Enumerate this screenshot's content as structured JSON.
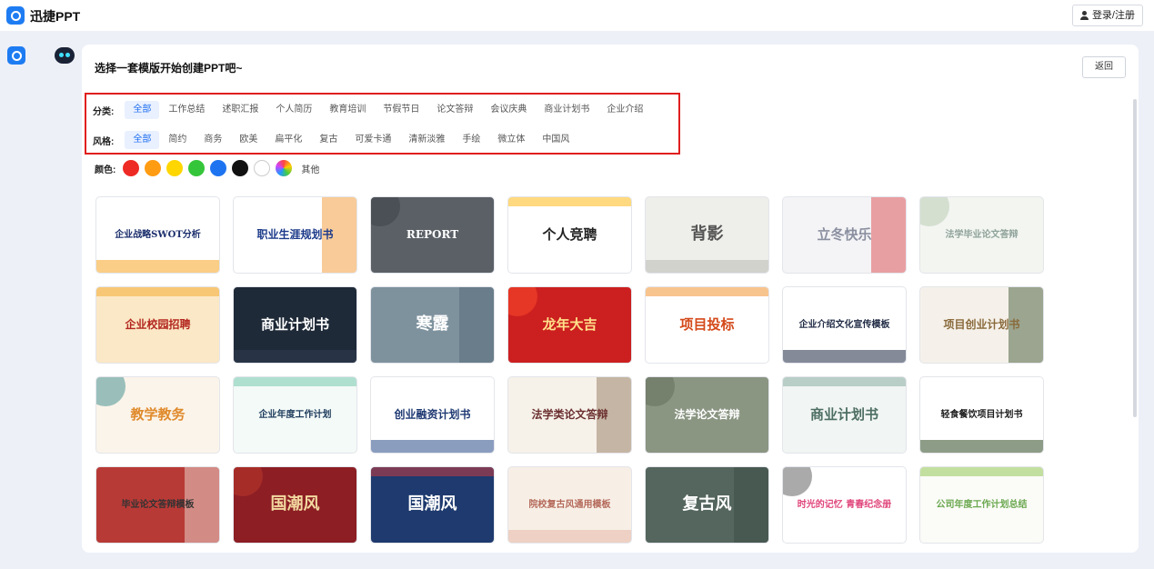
{
  "header": {
    "brand": "迅捷PPT",
    "login_label": "登录/注册"
  },
  "card": {
    "title": "选择一套模版开始创建PPT吧~",
    "back_label": "返回"
  },
  "filters": {
    "category_label": "分类:",
    "categories": [
      "全部",
      "工作总结",
      "述职汇报",
      "个人简历",
      "教育培训",
      "节假节日",
      "论文答辩",
      "会议庆典",
      "商业计划书",
      "企业介绍"
    ],
    "style_label": "风格:",
    "styles": [
      "全部",
      "简约",
      "商务",
      "欧美",
      "扁平化",
      "复古",
      "可爱卡通",
      "清新淡雅",
      "手绘",
      "微立体",
      "中国风"
    ],
    "color_label": "颜色:",
    "colors": [
      "#ee2a24",
      "#ff9c12",
      "#ffd600",
      "#35c53a",
      "#1e74f0",
      "#111111",
      "#ffffff",
      "rainbow"
    ],
    "other_label": "其他"
  },
  "templates": [
    {
      "text": "企业战略SWOT分析",
      "bg": "#ffffff",
      "fg": "#1a2d6b",
      "accent": "#f5a623"
    },
    {
      "text": "职业生涯规划书",
      "bg": "#ffffff",
      "fg": "#1c3a8a",
      "accent": "#f08c1a"
    },
    {
      "text": "REPORT",
      "bg": "#5a6066",
      "fg": "#ffffff",
      "accent": "#3a3f44"
    },
    {
      "text": "个人竞聘",
      "bg": "#ffffff",
      "fg": "#222222",
      "accent": "#ffb300"
    },
    {
      "text": "背影",
      "bg": "#eeeeea",
      "fg": "#555555",
      "accent": "#bbbbb4"
    },
    {
      "text": "立冬快乐",
      "bg": "#f4f4f6",
      "fg": "#8a8fa0",
      "accent": "#d9373b"
    },
    {
      "text": "法学毕业论文答辩",
      "bg": "#f3f5f1",
      "fg": "#8fa39a",
      "accent": "#b5c9b0"
    },
    {
      "text": "企业校园招聘",
      "bg": "#fbe8c6",
      "fg": "#b3261e",
      "accent": "#f5a623"
    },
    {
      "text": "商业计划书",
      "bg": "#1f2a38",
      "fg": "#ffffff",
      "accent": "#2f3d50"
    },
    {
      "text": "寒露",
      "bg": "#7e929e",
      "fg": "#ffffff",
      "accent": "#4f6470"
    },
    {
      "text": "龙年大吉",
      "bg": "#cc1f1f",
      "fg": "#ffe08a",
      "accent": "#ff4d2e"
    },
    {
      "text": "项目投标",
      "bg": "#ffffff",
      "fg": "#d4491a",
      "accent": "#f28a1e"
    },
    {
      "text": "企业介绍文化宣传模板",
      "bg": "#ffffff",
      "fg": "#1f2a44",
      "accent": "#1f2a44"
    },
    {
      "text": "项目创业计划书",
      "bg": "#f5f1ea",
      "fg": "#8a6a3b",
      "accent": "#2e4a22"
    },
    {
      "text": "教学教务",
      "bg": "#fbf4ea",
      "fg": "#e08a2c",
      "accent": "#3a8a8c"
    },
    {
      "text": "企业年度工作计划",
      "bg": "#f3faf7",
      "fg": "#1d3b5c",
      "accent": "#6cc4a8"
    },
    {
      "text": "创业融资计划书",
      "bg": "#ffffff",
      "fg": "#1f3a73",
      "accent": "#2c4d8a"
    },
    {
      "text": "法学类论文答辩",
      "bg": "#f6f2ea",
      "fg": "#6b2f2f",
      "accent": "#8a6a4f"
    },
    {
      "text": "法学论文答辩",
      "bg": "#8a9582",
      "fg": "#ffffff",
      "accent": "#5f6b58"
    },
    {
      "text": "商业计划书",
      "bg": "#f1f5f3",
      "fg": "#4d6e63",
      "accent": "#7fa89a"
    },
    {
      "text": "轻食餐饮项目计划书",
      "bg": "#ffffff",
      "fg": "#1b1b1b",
      "accent": "#2f4a22"
    },
    {
      "text": "毕业论文答辩模板",
      "bg": "#b83a36",
      "fg": "#333333",
      "accent": "#f3efe6"
    },
    {
      "text": "国潮风",
      "bg": "#8c1e24",
      "fg": "#f3d9a0",
      "accent": "#c0392b"
    },
    {
      "text": "国潮风",
      "bg": "#1e3a6e",
      "fg": "#ffffff",
      "accent": "#d93c3c"
    },
    {
      "text": "院校复古风通用模板",
      "bg": "#f7efe6",
      "fg": "#b4695a",
      "accent": "#e8b8a8"
    },
    {
      "text": "复古风",
      "bg": "#54665d",
      "fg": "#ffffff",
      "accent": "#3a4a42"
    },
    {
      "text": "时光的记忆 青春纪念册",
      "bg": "#ffffff",
      "fg": "#e0457b",
      "accent": "#555555"
    },
    {
      "text": "公司年度工作计划总结",
      "bg": "#fbfbf7",
      "fg": "#6aa84f",
      "accent": "#8bc34a"
    }
  ]
}
